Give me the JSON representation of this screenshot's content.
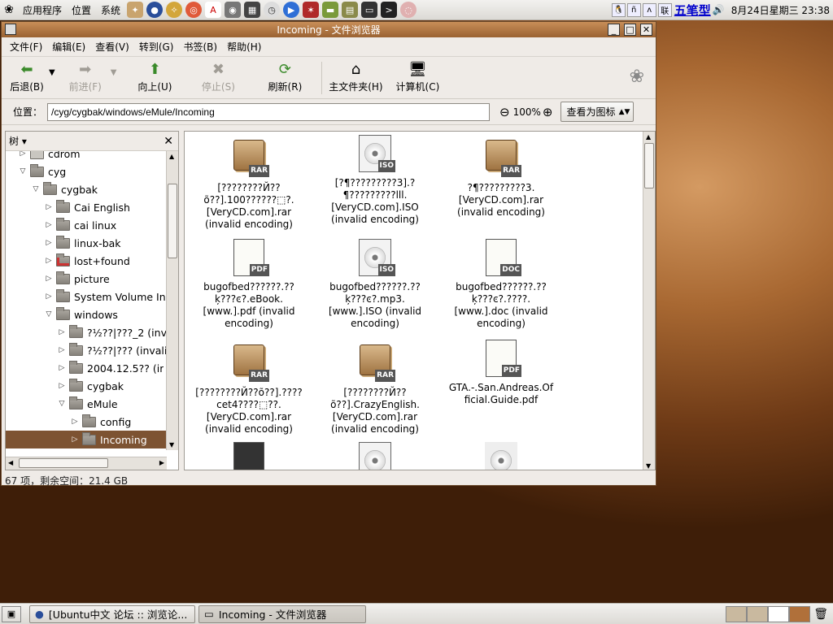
{
  "panel_top": {
    "menus": [
      "应用程序",
      "位置",
      "系统"
    ],
    "ime_label": "五笔型",
    "clock": "8月24日星期三 23:38",
    "tray_labels": [
      "ñ",
      "ʌ",
      "联"
    ]
  },
  "window": {
    "title": "Incoming - 文件浏览器",
    "menu": [
      "文件(F)",
      "编辑(E)",
      "查看(V)",
      "转到(G)",
      "书签(B)",
      "帮助(H)"
    ],
    "toolbar": {
      "back": "后退(B)",
      "forward": "前进(F)",
      "up": "向上(U)",
      "stop": "停止(S)",
      "reload": "刷新(R)",
      "home": "主文件夹(H)",
      "computer": "计算机(C)"
    },
    "location": {
      "label": "位置：",
      "path": "/cyg/cygbak/windows/eMule/Incoming",
      "zoom": "100%",
      "view_as": "查看为图标"
    },
    "sidebar": {
      "title": "树",
      "items": [
        {
          "label": "cdrom"
        },
        {
          "label": "cyg"
        },
        {
          "label": "cygbak"
        },
        {
          "label": "Cai English"
        },
        {
          "label": "cai linux"
        },
        {
          "label": "linux-bak"
        },
        {
          "label": "lost+found"
        },
        {
          "label": "picture"
        },
        {
          "label": "System Volume In"
        },
        {
          "label": "windows"
        },
        {
          "label": "?½??|???_2 (inv"
        },
        {
          "label": "?½??|??? (invali"
        },
        {
          "label": "2004.12.5?? (ir"
        },
        {
          "label": "cygbak"
        },
        {
          "label": "eMule"
        },
        {
          "label": "config"
        },
        {
          "label": "Incoming"
        }
      ]
    },
    "files": [
      {
        "name": "[????????Й??\nõ??].100??????⬚?.\n[VeryCD.com].rar\n(invalid encoding)",
        "type": "rar"
      },
      {
        "name": "[?¶?????????3].?\n¶?????????lll.\n[VeryCD.com].ISO\n(invalid encoding)",
        "type": "iso"
      },
      {
        "name": "?¶?????????3.\n[VeryCD.com].rar\n(invalid encoding)",
        "type": "rar"
      },
      {
        "name": "bugofbed??????.??\nķ???ͼ?.eBook.\n[www.].pdf (invalid\nencoding)",
        "type": "pdf"
      },
      {
        "name": "bugofbed??????.??\nķ???ͼ?.mp3.\n[www.].ISO (invalid\nencoding)",
        "type": "iso"
      },
      {
        "name": "bugofbed??????.??\nķ???ͼ?.????.\n[www.].doc (invalid\nencoding)",
        "type": "doc"
      },
      {
        "name": "[????????Й??õ??].????\ncet4????⬚??.\n[VeryCD.com].rar\n(invalid encoding)",
        "type": "rar"
      },
      {
        "name": "[????????Й??\nõ??].CrazyEnglish.\n[VeryCD.com].rar\n(invalid encoding)",
        "type": "rar"
      },
      {
        "name": "GTA.-.San.Andreas.Of\nficial.Guide.pdf",
        "type": "pdf"
      }
    ],
    "status": "67 项，剩余空间：21.4 GB"
  },
  "panel_bottom": {
    "tasks": [
      "[Ubuntu中文 论坛 :: 浏览论...",
      "Incoming - 文件浏览器"
    ]
  }
}
